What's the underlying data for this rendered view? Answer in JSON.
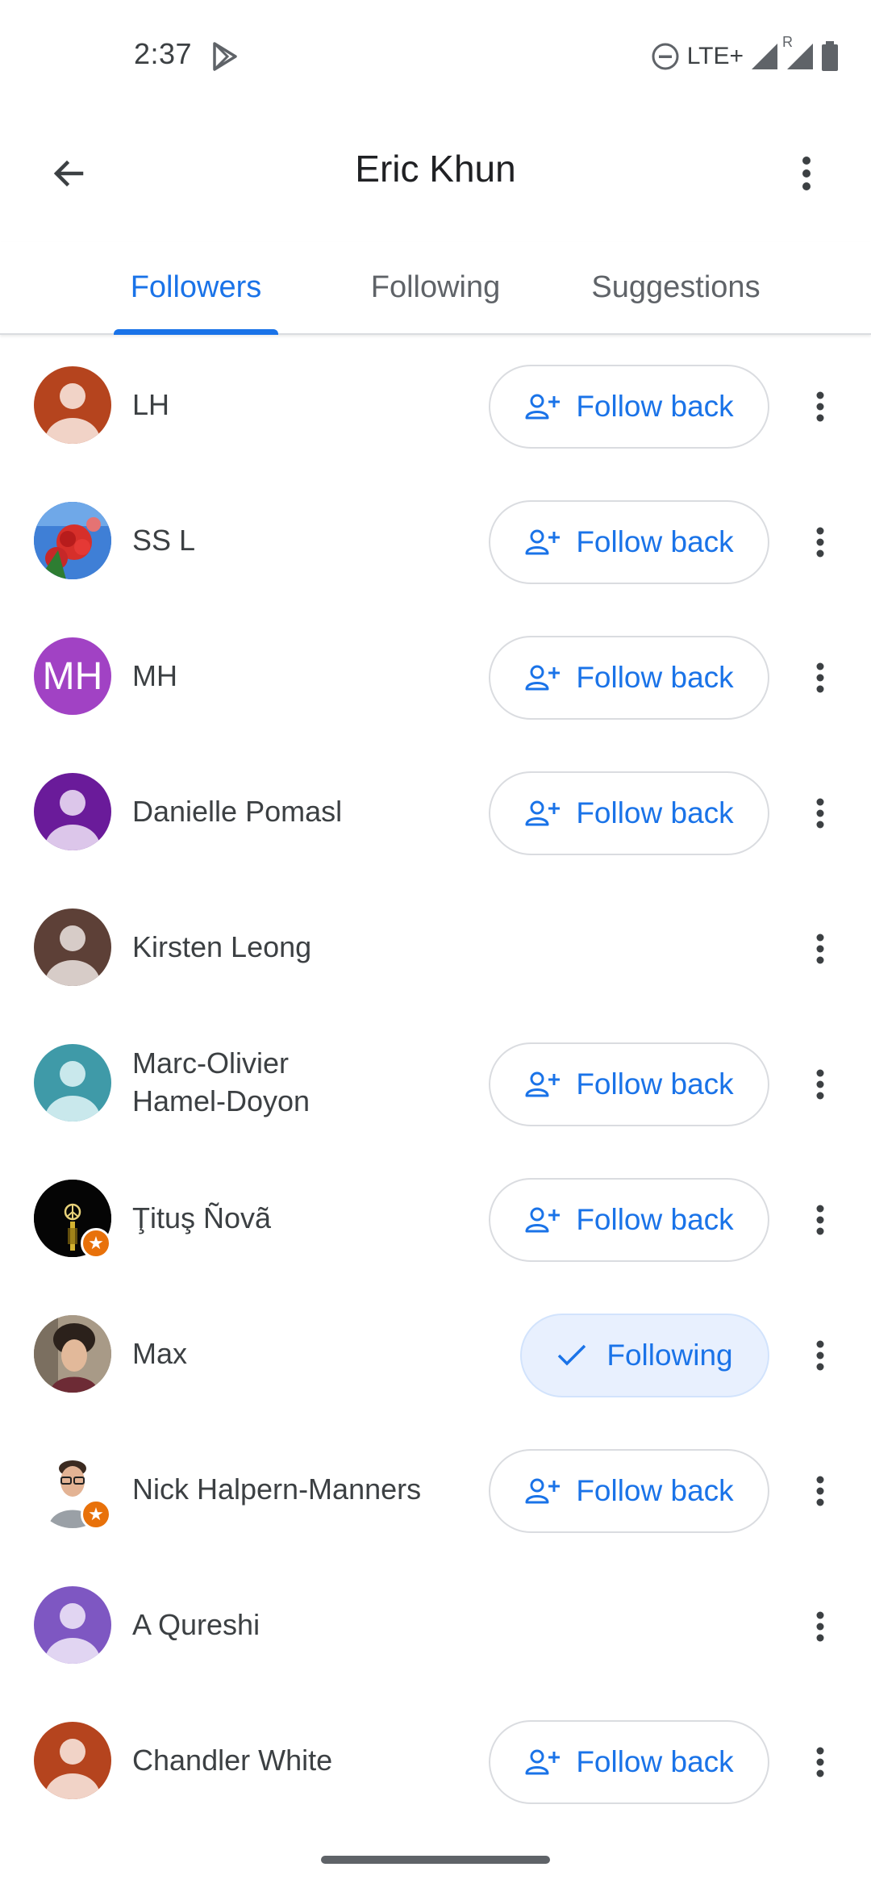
{
  "status_bar": {
    "time": "2:37",
    "network": "LTE+",
    "roaming": "R",
    "icons": [
      "play-icon",
      "do-not-disturb-icon",
      "signal-icon",
      "roaming-signal-icon",
      "battery-icon"
    ]
  },
  "app_bar": {
    "title": "Eric Khun",
    "back_icon": "arrow-back-icon",
    "menu_icon": "more-vert-icon"
  },
  "tabs": [
    {
      "label": "Followers",
      "active": true
    },
    {
      "label": "Following",
      "active": false
    },
    {
      "label": "Suggestions",
      "active": false
    }
  ],
  "colors": {
    "accent": "#1a73e8",
    "following_bg": "#e8f0fe",
    "badge": "#e8710a"
  },
  "rows": [
    {
      "name": "LH",
      "avatar": {
        "type": "silhouette",
        "bg": "#b5441e"
      },
      "action": "Follow back"
    },
    {
      "name": "SS L",
      "avatar": {
        "type": "photo-flowers"
      },
      "action": "Follow back"
    },
    {
      "name": "MH",
      "avatar": {
        "type": "initials",
        "text": "MH",
        "bg": "#a142c4"
      },
      "action": "Follow back"
    },
    {
      "name": "Danielle Pomasl",
      "avatar": {
        "type": "silhouette",
        "bg": "#6a1b9a"
      },
      "action": "Follow back"
    },
    {
      "name": "Kirsten Leong",
      "avatar": {
        "type": "silhouette",
        "bg": "#5d4037"
      },
      "action": ""
    },
    {
      "name_line1": "Marc-Olivier",
      "name_line2": "Hamel-Doyon",
      "avatar": {
        "type": "silhouette",
        "bg": "#3f9aa8"
      },
      "action": "Follow back"
    },
    {
      "name": "Ţituş Ñovã",
      "avatar": {
        "type": "photo-dark",
        "badge": true
      },
      "action": "Follow back"
    },
    {
      "name": "Max",
      "avatar": {
        "type": "photo-person"
      },
      "action": "Following"
    },
    {
      "name": "Nick Halpern-Manners",
      "avatar": {
        "type": "photo-person-glasses",
        "badge": true
      },
      "action": "Follow back"
    },
    {
      "name": "A Qureshi",
      "avatar": {
        "type": "silhouette",
        "bg": "#7e57c2"
      },
      "action": ""
    },
    {
      "name": "Chandler White",
      "avatar": {
        "type": "silhouette",
        "bg": "#b5441e"
      },
      "action": "Follow back"
    }
  ]
}
